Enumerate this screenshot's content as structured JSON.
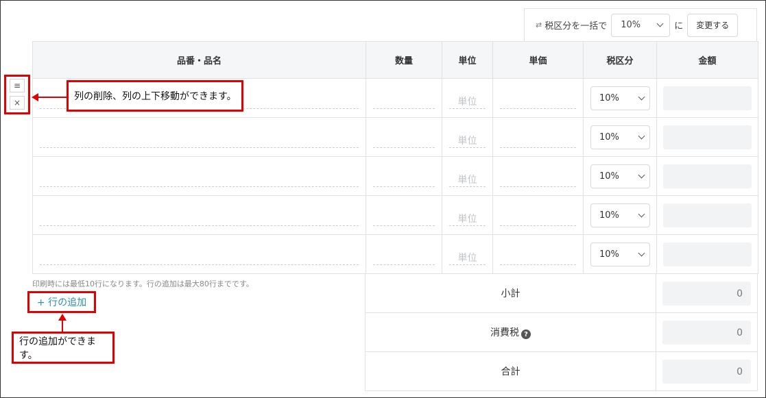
{
  "bulk_tax": {
    "icon": "swap-arrows-icon",
    "label": "税区分を一括で",
    "selected": "10%",
    "suffix": "に",
    "button": "変更する"
  },
  "columns": [
    "品番・品名",
    "数量",
    "単位",
    "単価",
    "税区分",
    "金額"
  ],
  "rows": [
    {
      "unit_placeholder": "単位",
      "tax": "10%"
    },
    {
      "unit_placeholder": "単位",
      "tax": "10%"
    },
    {
      "unit_placeholder": "単位",
      "tax": "10%"
    },
    {
      "unit_placeholder": "単位",
      "tax": "10%"
    },
    {
      "unit_placeholder": "単位",
      "tax": "10%"
    }
  ],
  "row_handle": {
    "menu": "≡",
    "delete": "×"
  },
  "note": "印刷時には最低10行になります。行の追加は最大80行までです。",
  "add_row": "+ 行の追加",
  "summary": [
    {
      "label": "小計",
      "value": "0"
    },
    {
      "label": "消費税",
      "value": "0",
      "help": "?"
    },
    {
      "label": "合計",
      "value": "0"
    }
  ],
  "annotations": {
    "row_actions": "列の削除、列の上下移動ができます。",
    "add_row": "行の追加ができます。"
  },
  "colors": {
    "annotation": "#e00000",
    "link": "#2d8fa8",
    "header_bg": "#f5f6f8"
  }
}
